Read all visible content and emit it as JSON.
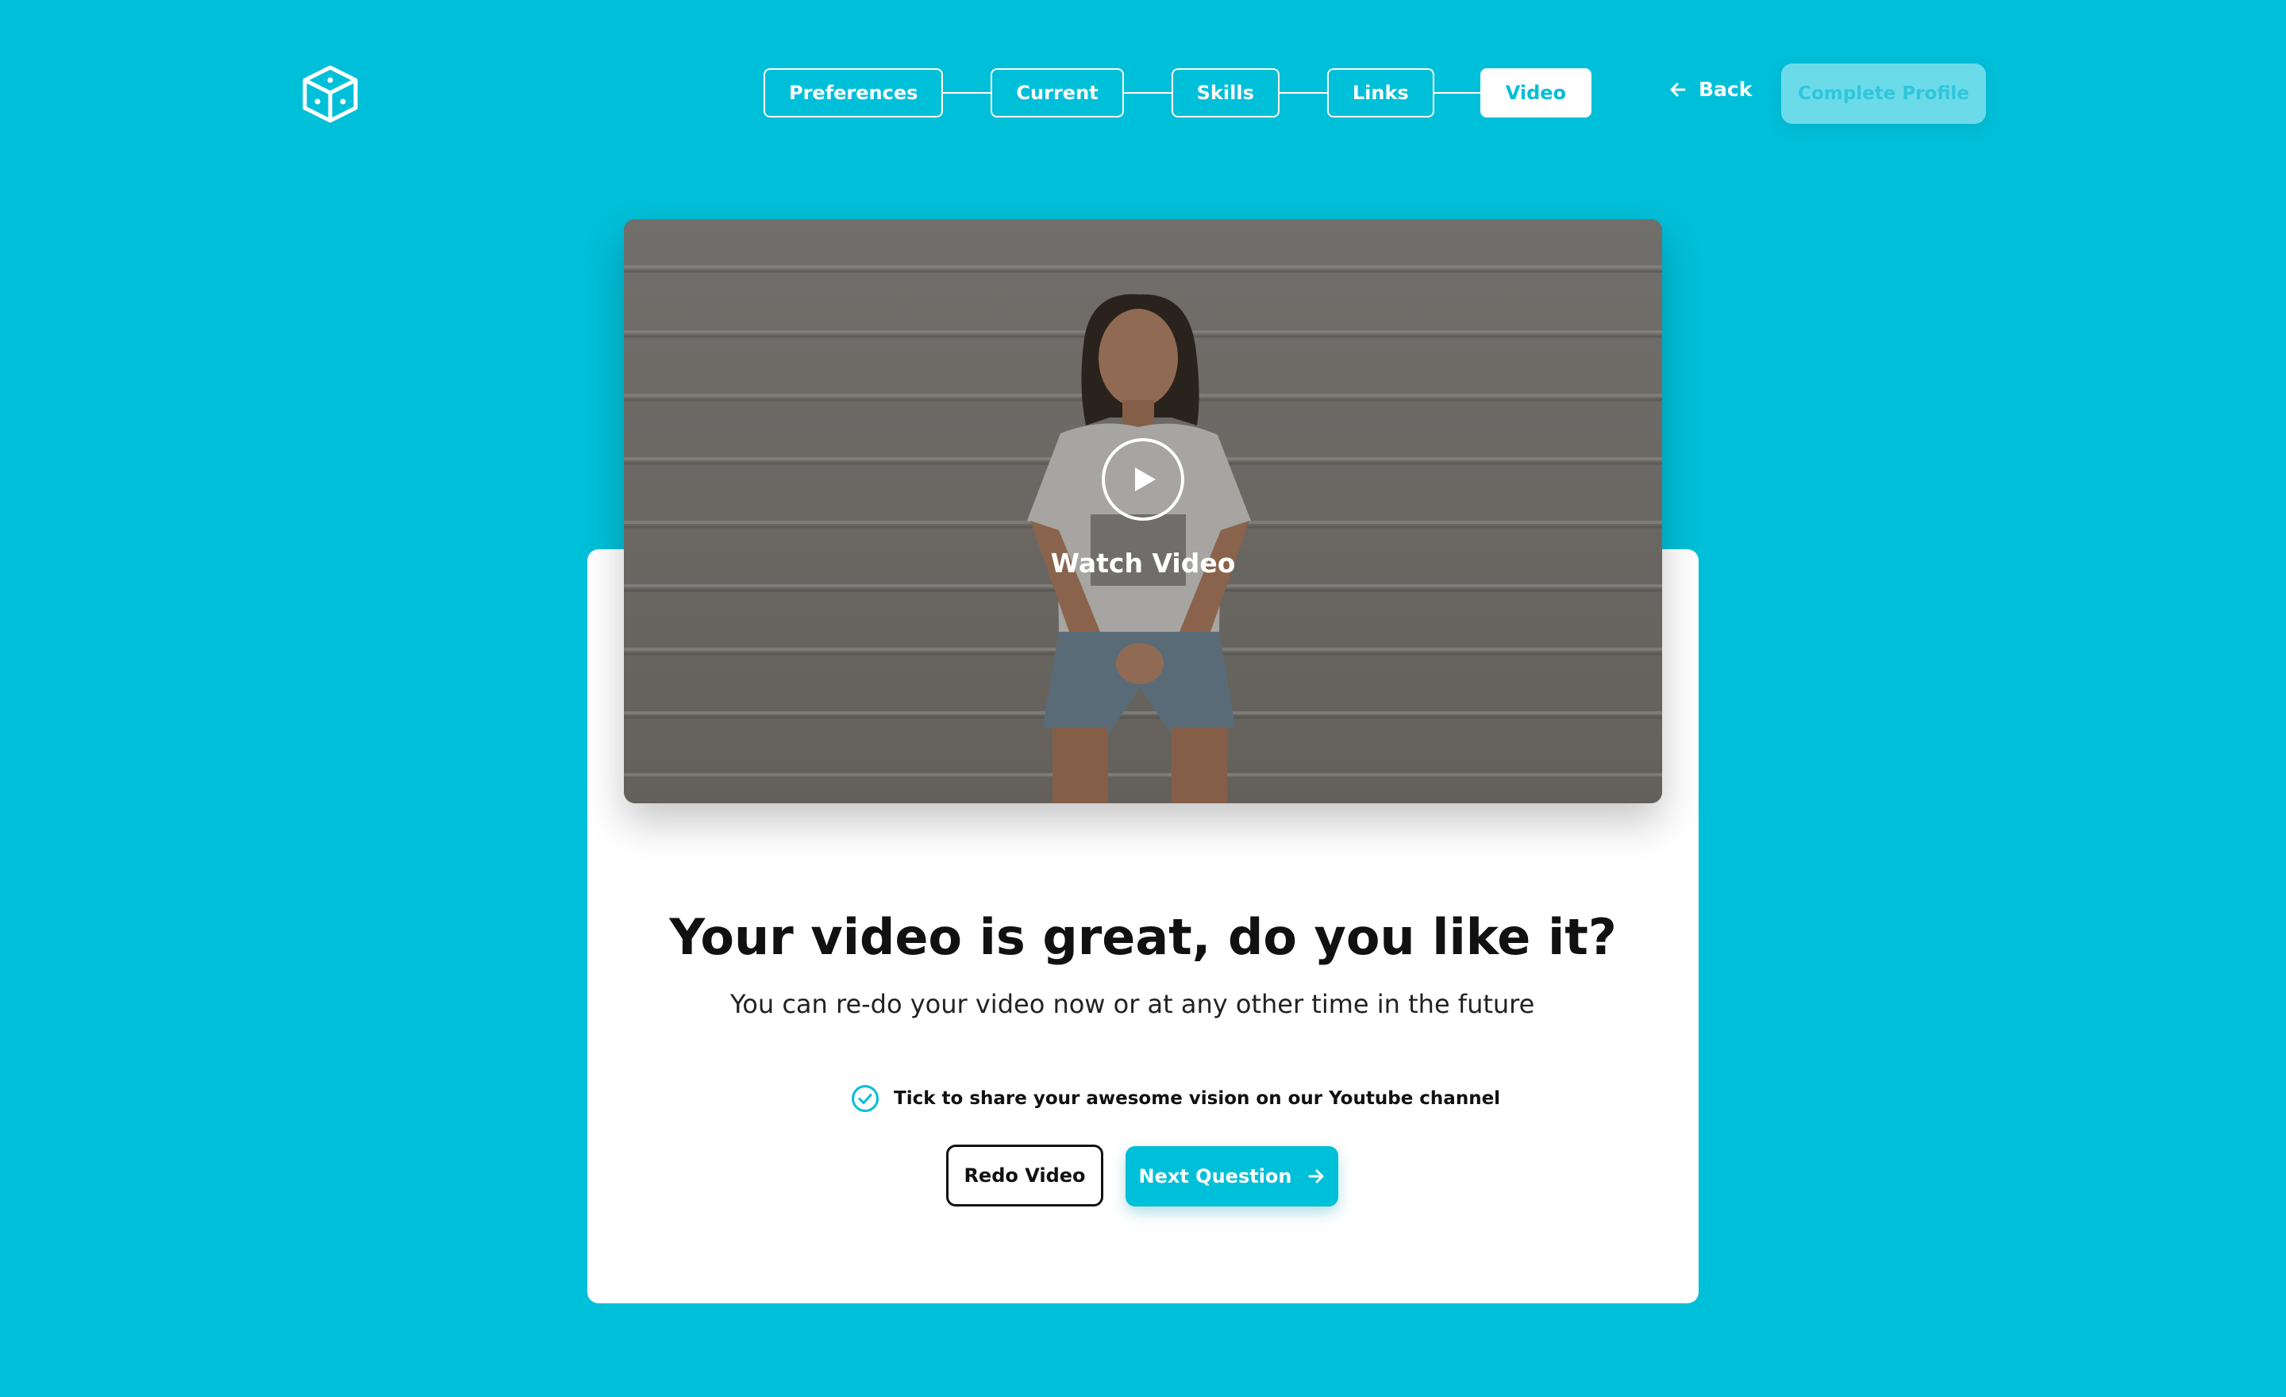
{
  "header": {
    "logo_icon": "cube-dice-icon",
    "steps": [
      {
        "label": "Preferences",
        "active": false
      },
      {
        "label": "Current",
        "active": false
      },
      {
        "label": "Skills",
        "active": false
      },
      {
        "label": "Links",
        "active": false
      },
      {
        "label": "Video",
        "active": true
      }
    ],
    "back_label": "Back",
    "back_icon": "arrow-left-icon",
    "complete_label": "Complete Profile"
  },
  "video": {
    "play_icon": "play-icon",
    "watch_label": "Watch Video"
  },
  "card": {
    "headline": "Your video is great, do you like it?",
    "subline": "You can re-do your video now or at any other time in the future",
    "share_checked": true,
    "share_label": "Tick to share your awesome vision on our Youtube channel",
    "redo_label": "Redo Video",
    "next_label": "Next Question",
    "next_icon": "arrow-right-icon"
  },
  "colors": {
    "background": "#00bfd8",
    "card": "#ffffff",
    "accent": "#00bfd8",
    "complete_button": "#6bdbea",
    "text": "#111111"
  }
}
